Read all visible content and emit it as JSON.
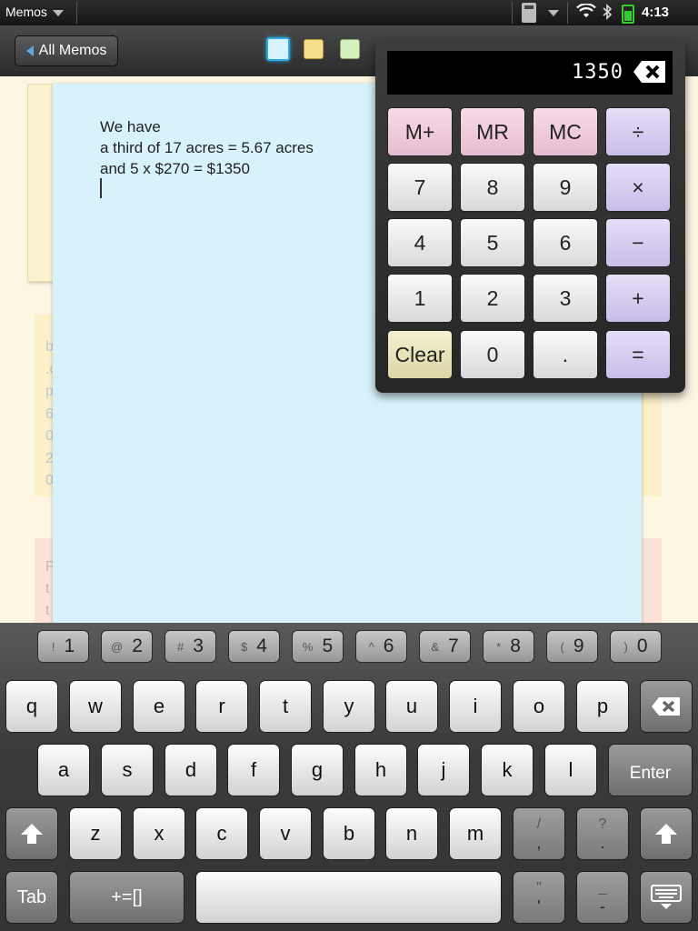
{
  "status_bar": {
    "app_name": "Memos",
    "time": "4:13",
    "icons": [
      "calculator-icon",
      "wifi-icon",
      "bluetooth-icon",
      "battery-charging-icon"
    ]
  },
  "toolbar": {
    "back_label": "All Memos",
    "colors": {
      "blue": "#d8f3fc",
      "yellow": "#f5df8a",
      "green": "#d6efbf"
    }
  },
  "memo": {
    "lines": [
      "We have",
      "a third of 17 acres = 5.67 acres",
      "and 5 x $270 = $1350"
    ],
    "color": "#d8f2fb"
  },
  "background_peeks": {
    "yellow_memo": [
      "b",
      ".c",
      "p",
      "6",
      "0",
      "2",
      "0"
    ],
    "pink_memo": [
      "F",
      "t",
      "t"
    ]
  },
  "calculator": {
    "display": "1350",
    "memory": {
      "m_plus": "M+",
      "mr": "MR",
      "mc": "MC"
    },
    "ops": {
      "divide": "÷",
      "multiply": "×",
      "minus": "−",
      "plus": "+",
      "equals": "="
    },
    "digits": [
      "0",
      "1",
      "2",
      "3",
      "4",
      "5",
      "6",
      "7",
      "8",
      "9"
    ],
    "decimal": ".",
    "clear": "Clear"
  },
  "keyboard": {
    "number_row": [
      {
        "sym": "!",
        "num": "1"
      },
      {
        "sym": "@",
        "num": "2"
      },
      {
        "sym": "#",
        "num": "3"
      },
      {
        "sym": "$",
        "num": "4"
      },
      {
        "sym": "%",
        "num": "5"
      },
      {
        "sym": "^",
        "num": "6"
      },
      {
        "sym": "&",
        "num": "7"
      },
      {
        "sym": "*",
        "num": "8"
      },
      {
        "sym": "(",
        "num": "9"
      },
      {
        "sym": ")",
        "num": "0"
      }
    ],
    "row1": [
      "q",
      "w",
      "e",
      "r",
      "t",
      "y",
      "u",
      "i",
      "o",
      "p"
    ],
    "row2": [
      "a",
      "s",
      "d",
      "f",
      "g",
      "h",
      "j",
      "k",
      "l"
    ],
    "row3": [
      "z",
      "x",
      "c",
      "v",
      "b",
      "n",
      "m"
    ],
    "enter": "Enter",
    "tab": "Tab",
    "symbols": "+=[]",
    "comma_key": {
      "top": "/",
      "bottom": ","
    },
    "period_key": {
      "top": "?",
      "bottom": "."
    },
    "quote_key": {
      "top": "\"",
      "bottom": "'"
    },
    "dash_key": {
      "top": "_",
      "bottom": "-"
    }
  }
}
